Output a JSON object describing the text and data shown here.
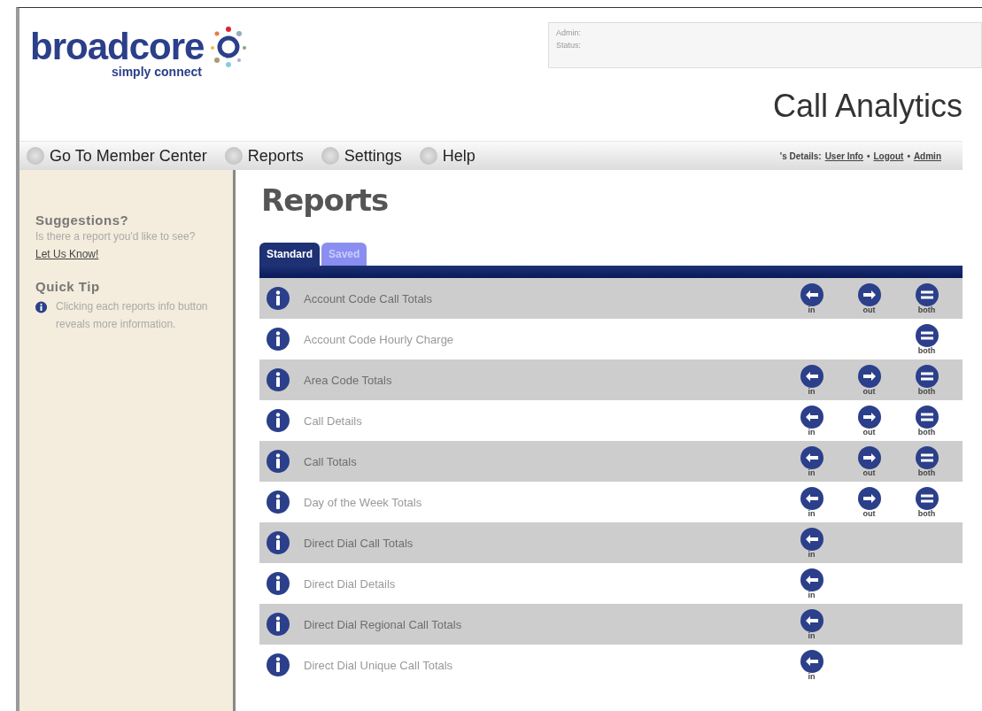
{
  "logo": {
    "name": "broadcore",
    "tagline": "simply connect"
  },
  "status_box": {
    "lines": [
      "Admin:",
      "Status:"
    ]
  },
  "app_title": "Call Analytics",
  "nav": {
    "items": [
      "Go To Member Center",
      "Reports",
      "Settings",
      "Help"
    ],
    "details_label": "'s Details:",
    "links": [
      "User Info",
      "Logout",
      "Admin"
    ],
    "separator": "•"
  },
  "sidebar": {
    "suggestions_title": "Suggestions?",
    "suggestions_text": "Is there a report you'd like to see?",
    "suggestions_link": "Let Us Know!",
    "tip_title": "Quick Tip",
    "tip_text": "Clicking each reports info button reveals more information."
  },
  "page_title": "Reports",
  "tabs": [
    {
      "label": "Standard",
      "selected": true
    },
    {
      "label": "Saved",
      "selected": false
    }
  ],
  "reports": [
    {
      "name": "Account Code Call Totals",
      "directions": [
        {
          "kind": "in",
          "label": "in"
        },
        {
          "kind": "out",
          "label": "out"
        },
        {
          "kind": "both",
          "label": "both"
        }
      ]
    },
    {
      "name": "Account Code Hourly Charge",
      "directions": [
        {
          "kind": "both",
          "label": "both"
        }
      ]
    },
    {
      "name": "Area Code Totals",
      "directions": [
        {
          "kind": "in",
          "label": "in"
        },
        {
          "kind": "out",
          "label": "out"
        },
        {
          "kind": "both",
          "label": "both"
        }
      ]
    },
    {
      "name": "Call Details",
      "directions": [
        {
          "kind": "in",
          "label": "in"
        },
        {
          "kind": "out",
          "label": "out"
        },
        {
          "kind": "both",
          "label": "both"
        }
      ]
    },
    {
      "name": "Call Totals",
      "directions": [
        {
          "kind": "in",
          "label": "in"
        },
        {
          "kind": "out",
          "label": "out"
        },
        {
          "kind": "both",
          "label": "both"
        }
      ]
    },
    {
      "name": "Day of the Week Totals",
      "directions": [
        {
          "kind": "in",
          "label": "in"
        },
        {
          "kind": "out",
          "label": "out"
        },
        {
          "kind": "both",
          "label": "both"
        }
      ]
    },
    {
      "name": "Direct Dial Call Totals",
      "directions": [
        {
          "kind": "in",
          "label": "in"
        }
      ]
    },
    {
      "name": "Direct Dial Details",
      "directions": [
        {
          "kind": "in",
          "label": "in"
        }
      ]
    },
    {
      "name": "Direct Dial Regional Call Totals",
      "directions": [
        {
          "kind": "in",
          "label": "in"
        }
      ]
    },
    {
      "name": "Direct Dial Unique Call Totals",
      "directions": [
        {
          "kind": "in",
          "label": "in"
        }
      ]
    }
  ]
}
